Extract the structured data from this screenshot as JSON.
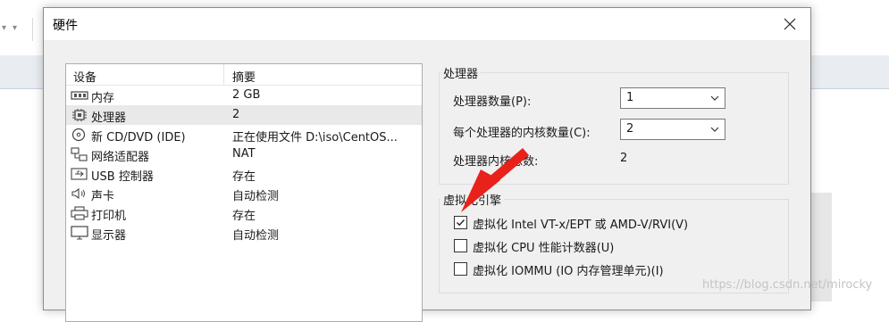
{
  "dialog": {
    "title": "硬件"
  },
  "device_list": {
    "headers": {
      "device": "设备",
      "summary": "摘要"
    },
    "rows": [
      {
        "icon": "memory-icon",
        "name": "内存",
        "summary": "2 GB",
        "selected": false
      },
      {
        "icon": "processor-icon",
        "name": "处理器",
        "summary": "2",
        "selected": true
      },
      {
        "icon": "cd-dvd-icon",
        "name": "新 CD/DVD (IDE)",
        "summary": "正在使用文件 D:\\iso\\CentOS...",
        "selected": false
      },
      {
        "icon": "network-adapter-icon",
        "name": "网络适配器",
        "summary": "NAT",
        "selected": false
      },
      {
        "icon": "usb-icon",
        "name": "USB 控制器",
        "summary": "存在",
        "selected": false
      },
      {
        "icon": "sound-icon",
        "name": "声卡",
        "summary": "自动检测",
        "selected": false
      },
      {
        "icon": "printer-icon",
        "name": "打印机",
        "summary": "存在",
        "selected": false
      },
      {
        "icon": "display-icon",
        "name": "显示器",
        "summary": "自动检测",
        "selected": false
      }
    ]
  },
  "processor": {
    "group_label": "处理器",
    "count_label": "处理器数量(P):",
    "count_value": "1",
    "cores_label": "每个处理器的内核数量(C):",
    "cores_value": "2",
    "total_label": "处理器内核总数:",
    "total_value": "2"
  },
  "virtualization": {
    "group_label": "虚拟化引擎",
    "options": [
      {
        "label": "虚拟化 Intel VT-x/EPT 或 AMD-V/RVI(V)",
        "checked": true
      },
      {
        "label": "虚拟化 CPU 性能计数器(U)",
        "checked": false
      },
      {
        "label": "虚拟化 IOMMU (IO 内存管理单元)(I)",
        "checked": false
      }
    ]
  },
  "annotation": {
    "arrow_color": "#e8221b"
  },
  "watermark": "https://blog.csdn.net/mirocky"
}
